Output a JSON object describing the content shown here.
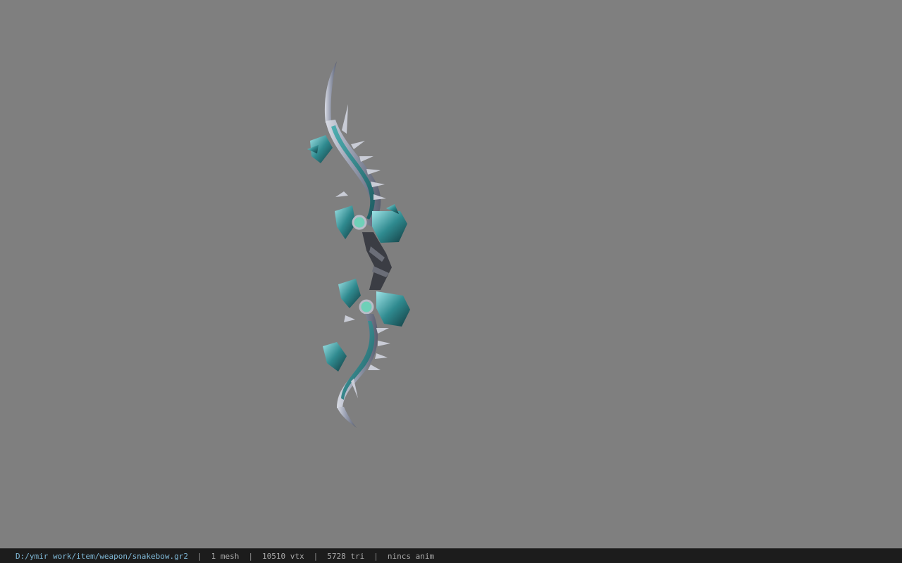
{
  "viewer": {
    "background_color": "#7f7f7f",
    "model_name": "snakebow"
  },
  "status": {
    "path": "D:/ymir work/item/weapon/snakebow.gr2",
    "separator": "|",
    "mesh": "1 mesh",
    "vtx": "10510 vtx",
    "tri": "5728 tri",
    "anim": "nincs anim"
  },
  "colors": {
    "status_bg": "#1c1c1c",
    "path_text": "#7fb8d6",
    "status_text": "#a9a9a9",
    "bow_crystal": "#2f8a8f",
    "bow_metal": "#b9bcc8"
  }
}
